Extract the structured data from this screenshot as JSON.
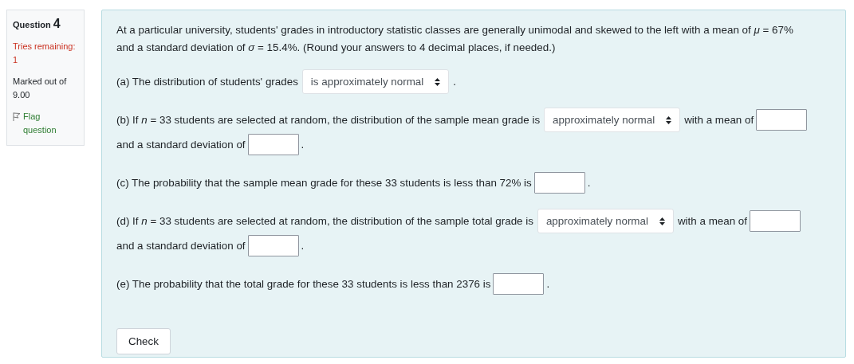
{
  "info": {
    "question_label": "Question",
    "question_number": "4",
    "tries_label": "Tries remaining:",
    "tries_value": "1",
    "marked_label": "Marked out of",
    "marked_value": "9.00",
    "flag_label": "Flag question",
    "flagged": false
  },
  "parts": [
    {
      "lines": [
        [
          {
            "kind": "text",
            "text": "At a particular university, students' grades in introductory statistic classes are generally unimodal and skewed to the left with a mean of *μ* = 67%"
          }
        ],
        [
          {
            "kind": "text",
            "text": "and a standard deviation of *σ* = 15.4%. (Round your answers to 4 decimal places, if needed.)"
          }
        ]
      ]
    },
    {
      "lines": [
        [
          {
            "kind": "text",
            "text": "(a) The distribution of students' grades"
          },
          {
            "kind": "select",
            "text": "is approximately normal"
          },
          {
            "kind": "text",
            "text": "."
          }
        ]
      ]
    },
    {
      "lines": [
        [
          {
            "kind": "text",
            "text": "(b) If *n* = 33 students are selected at random, the distribution of the sample mean grade is"
          },
          {
            "kind": "select",
            "text": "approximately normal"
          },
          {
            "kind": "text",
            "text": "with a mean of"
          },
          {
            "kind": "input"
          }
        ],
        [
          {
            "kind": "text",
            "text": "and a standard deviation of"
          },
          {
            "kind": "input"
          },
          {
            "kind": "text",
            "text": "."
          }
        ]
      ]
    },
    {
      "lines": [
        [
          {
            "kind": "text",
            "text": "(c) The probability that the sample mean grade for these 33 students is less than 72% is"
          },
          {
            "kind": "input"
          },
          {
            "kind": "text",
            "text": "."
          }
        ]
      ]
    },
    {
      "lines": [
        [
          {
            "kind": "text",
            "text": "(d) If *n* = 33 students are selected at random, the distribution of the sample total grade is"
          },
          {
            "kind": "select",
            "text": "approximately normal"
          },
          {
            "kind": "text",
            "text": "with a mean of"
          },
          {
            "kind": "input"
          }
        ],
        [
          {
            "kind": "text",
            "text": "and a standard deviation of"
          },
          {
            "kind": "input"
          },
          {
            "kind": "text",
            "text": "."
          }
        ]
      ]
    },
    {
      "lines": [
        [
          {
            "kind": "text",
            "text": "(e) The probability that the total grade for these 33 students is less than 2376 is"
          },
          {
            "kind": "input"
          },
          {
            "kind": "text",
            "text": "."
          }
        ]
      ]
    }
  ],
  "check_button": "Check"
}
